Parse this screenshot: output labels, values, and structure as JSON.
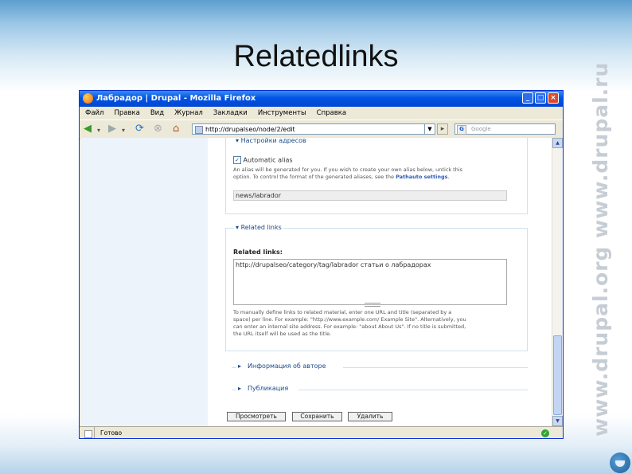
{
  "slide": {
    "title": "Relatedlinks",
    "side_brand": "www.drupal.org   www.drupal.ru"
  },
  "browser": {
    "title": "Лабрадор | Drupal - Mozilla Firefox",
    "window_buttons": {
      "minimize": "_",
      "maximize": "□",
      "close": "×"
    },
    "menu": [
      "Файл",
      "Правка",
      "Вид",
      "Журнал",
      "Закладки",
      "Инструменты",
      "Справка"
    ],
    "url": "http://drupalseo/node/2/edit",
    "search_placeholder": "Google",
    "status_text": "Готово"
  },
  "icons": {
    "back": "back-arrow-icon",
    "forward": "forward-arrow-icon",
    "reload": "reload-icon",
    "stop": "stop-icon",
    "home": "home-icon"
  },
  "form": {
    "url_settings": {
      "legend": "Настройки адресов",
      "checkbox_label": "Automatic alias",
      "help_line1": "An alias will be generated for you. If you wish to create your own alias below, untick this",
      "help_line2": "option. To control the format of the generated aliases, see the",
      "help_link": "Pathauto settings",
      "alias_value": "news/labrador"
    },
    "related_links": {
      "legend": "Related links",
      "field_label": "Related links:",
      "textarea_value": "http://drupalseo/category/tag/labrador статьи о лабрадорах",
      "help_line1": "To manually define links to related material, enter one URL and title (separated by a",
      "help_line2": "space) per line. For example: \"http://www.example.com/ Example Site\". Alternatively, you",
      "help_line3": "can enter an internal site address. For example: \"about About Us\". If no title is submitted,",
      "help_line4": "the URL itself will be used as the title."
    },
    "author_info": "Информация об авторе",
    "publishing": "Публикация",
    "buttons": {
      "preview": "Просмотреть",
      "save": "Сохранить",
      "delete": "Удалить"
    }
  }
}
